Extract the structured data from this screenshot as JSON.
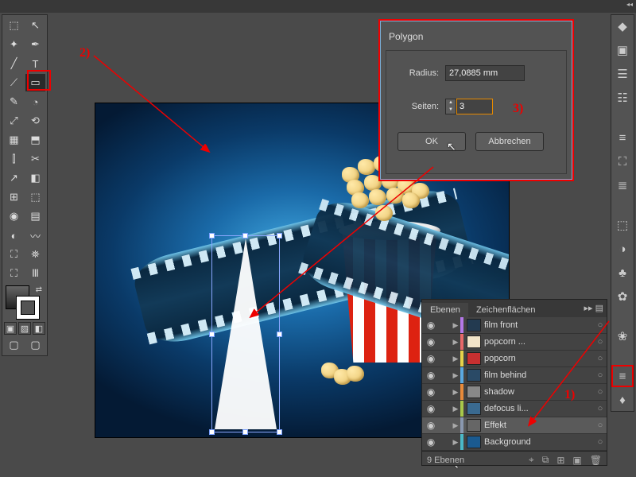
{
  "annotations": {
    "step1": "1)",
    "step2": "2)",
    "step3": "3)"
  },
  "dialog": {
    "title": "Polygon",
    "radius_label": "Radius:",
    "radius_value": "27,0885 mm",
    "sides_label": "Seiten:",
    "sides_value": "3",
    "ok": "OK",
    "cancel": "Abbrechen"
  },
  "layers_panel": {
    "tab_layers": "Ebenen",
    "tab_artboards": "Zeichenflächen",
    "rows": [
      {
        "name": "film front",
        "color": "#b478e8",
        "thumb": "#233a50"
      },
      {
        "name": "popcorn ...",
        "color": "#e86868",
        "thumb": "#f2e4c8"
      },
      {
        "name": "popcorn",
        "color": "#e6d24a",
        "thumb": "#c83030"
      },
      {
        "name": "film behind",
        "color": "#5aa8e0",
        "thumb": "#2a4a66"
      },
      {
        "name": "shadow",
        "color": "#e88a3a",
        "thumb": "#888"
      },
      {
        "name": "defocus li...",
        "color": "#a8c84a",
        "thumb": "#3a6a90"
      },
      {
        "name": "Effekt",
        "color": "#8a98b0",
        "thumb": "#666",
        "selected": true
      },
      {
        "name": "Background",
        "color": "#4ab8c8",
        "thumb": "#1a5a90"
      }
    ],
    "footer_count": "9 Ebenen"
  },
  "tools_left": [
    "⬚",
    "↖",
    "✦",
    "✒",
    "╱",
    "T",
    "⟋",
    "▭",
    "✎",
    "◔",
    "⤢",
    "⟲",
    "▦",
    "⬒",
    "⫿",
    "✂",
    "↗",
    "◧",
    "⊞",
    "⬚",
    "◉",
    "▤",
    "◐",
    "〰",
    "⛶",
    "⛯",
    "⛶",
    "Ⅲ",
    "⬚",
    "☼",
    "◢",
    "✋"
  ],
  "tools_right": [
    "◆",
    "▣",
    "☰",
    "☷",
    "≡",
    "⛶",
    "≣",
    "⬚",
    "◑",
    "♣",
    "✿",
    "❀",
    "≡",
    "♦"
  ],
  "swatch_row": [
    "▣",
    "▨",
    "◧"
  ],
  "chart_data": null
}
